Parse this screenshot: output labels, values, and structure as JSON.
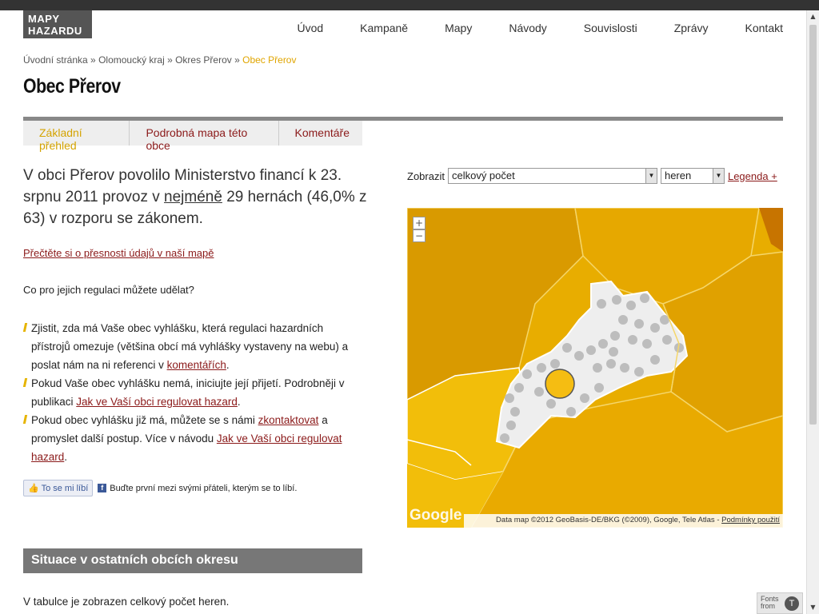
{
  "logo": {
    "line1": "MAPY",
    "line2": "HAZARDU"
  },
  "nav": [
    "Úvod",
    "Kampaně",
    "Mapy",
    "Návody",
    "Souvislosti",
    "Zprávy",
    "Kontakt"
  ],
  "breadcrumb": {
    "items": [
      "Úvodní stránka",
      "Olomoucký kraj",
      "Okres Přerov"
    ],
    "current": "Obec Přerov",
    "separator": " » "
  },
  "page_title": "Obec Přerov",
  "tabs": [
    "Základní přehled",
    "Podrobná mapa této obce",
    "Komentáře"
  ],
  "lead": {
    "part1": "V obci Přerov povolilo Ministerstvo financí k 23. srpnu 2011 provoz v ",
    "emph": "nejméně",
    "part2": " 29 hernách (46,0% z 63) v rozporu se zákonem."
  },
  "accuracy_link": "Přečtěte si o přesnosti údajů v naší mapě",
  "question": "Co pro jejich regulaci můžete udělat?",
  "tips": {
    "t1_text": "Zjistit, zda má Vaše obec vyhlášku, která regulaci hazardních přístrojů omezuje (většina obcí má vyhlášky vystaveny na webu) a poslat nám na ni referenci v ",
    "t1_link": "komentářích",
    "t1_end": ".",
    "t2_text": "Pokud Vaše obec vyhlášku nemá, iniciujte její přijetí. Podrobněji v publikaci ",
    "t2_link": "Jak ve Vaší obci regulovat hazard",
    "t2_end": ".",
    "t3_text": "Pokud obec vyhlášku již má, můžete se s námi ",
    "t3_link": "zkontaktovat",
    "t3_mid": " a promyslet další postup. Více v návodu ",
    "t3_link2": "Jak ve Vaší obci regulovat hazard",
    "t3_end": "."
  },
  "like": {
    "button": "To se mi líbí",
    "text": "Buďte první mezi svými přáteli, kterým se to líbí."
  },
  "section_head": "Situace v ostatních obcích okresu",
  "table_note": "V tabulce je zobrazen celkový počet heren.",
  "controls": {
    "label": "Zobrazit",
    "select1": "celkový počet",
    "select2": "heren",
    "legend_link": "Legenda +"
  },
  "map": {
    "zoom_in": "+",
    "zoom_out": "−",
    "google": "Google",
    "attribution": "Data map ©2012 GeoBasis-DE/BKG (©2009), Google, Tele Atlas - ",
    "terms": "Podmínky použití",
    "colors": {
      "dark": "#d99a00",
      "mid": "#e8ad00",
      "light": "#f2be0a",
      "deep": "#c77400",
      "marker": "#f5bd12"
    }
  },
  "fonts_badge": {
    "line1": "Fonts",
    "line2": "from"
  }
}
